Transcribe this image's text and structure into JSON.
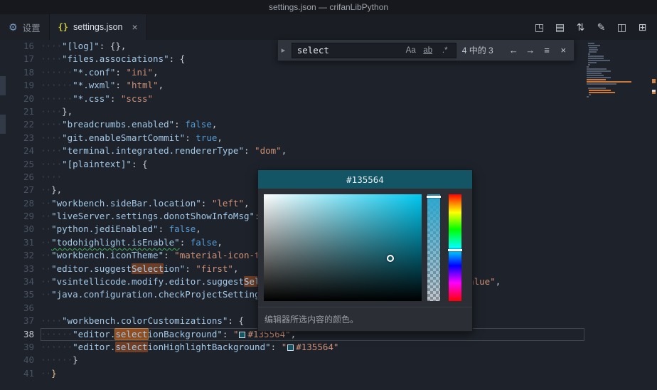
{
  "window": {
    "title": "settings.json — crifanLibPython"
  },
  "tab_bar": {
    "tabs": [
      {
        "label": "设置",
        "icon_name": "settings-gear-icon",
        "icon_glyph": "⚙",
        "icon_class": "ic-settings",
        "active": false
      },
      {
        "label": "settings.json",
        "icon_name": "json-braces-icon",
        "icon_glyph": "{}",
        "icon_class": "ic-json",
        "active": true,
        "close_glyph": "×"
      }
    ],
    "actions": [
      {
        "name": "open-changes-icon",
        "glyph": "◳"
      },
      {
        "name": "open-preview-icon",
        "glyph": "▤"
      },
      {
        "name": "synchronize-icon",
        "glyph": "⇅"
      },
      {
        "name": "edit-settings-icon",
        "glyph": "✎"
      },
      {
        "name": "split-editor-icon",
        "glyph": "◫"
      },
      {
        "name": "editor-layout-icon",
        "glyph": "⊞"
      }
    ]
  },
  "find_widget": {
    "collapse_glyph": "▸",
    "query": "select",
    "match_case_label": "Aa",
    "whole_word_label": "ab",
    "regex_label": ".*",
    "matches_label": "4 中的 3",
    "prev_glyph": "←",
    "next_glyph": "→",
    "selection_glyph": "≡",
    "close_glyph": "×"
  },
  "color_picker": {
    "hex": "#135564",
    "caption": "编辑器所选内容的颜色。"
  },
  "editor": {
    "lines": [
      {
        "num": 16,
        "tokens": [
          {
            "t": "ws",
            "n": 4
          },
          {
            "t": "key",
            "v": "\"[log]\""
          },
          {
            "t": "p",
            "v": ": "
          },
          {
            "t": "p",
            "v": "{},"
          }
        ]
      },
      {
        "num": 17,
        "tokens": [
          {
            "t": "ws",
            "n": 4
          },
          {
            "t": "key",
            "v": "\"files.associations\""
          },
          {
            "t": "p",
            "v": ": "
          },
          {
            "t": "p",
            "v": "{"
          }
        ]
      },
      {
        "num": 18,
        "tokens": [
          {
            "t": "ws",
            "n": 6
          },
          {
            "t": "key",
            "v": "\"*.conf\""
          },
          {
            "t": "p",
            "v": ": "
          },
          {
            "t": "str",
            "v": "\"ini\""
          },
          {
            "t": "p",
            "v": ","
          }
        ]
      },
      {
        "num": 19,
        "tokens": [
          {
            "t": "ws",
            "n": 6
          },
          {
            "t": "key",
            "v": "\"*.wxml\""
          },
          {
            "t": "p",
            "v": ": "
          },
          {
            "t": "str",
            "v": "\"html\""
          },
          {
            "t": "p",
            "v": ","
          }
        ]
      },
      {
        "num": 20,
        "tokens": [
          {
            "t": "ws",
            "n": 6
          },
          {
            "t": "key",
            "v": "\"*.css\""
          },
          {
            "t": "p",
            "v": ": "
          },
          {
            "t": "str",
            "v": "\"scss\""
          }
        ]
      },
      {
        "num": 21,
        "tokens": [
          {
            "t": "ws",
            "n": 4
          },
          {
            "t": "p",
            "v": "},"
          }
        ]
      },
      {
        "num": 22,
        "tokens": [
          {
            "t": "ws",
            "n": 4
          },
          {
            "t": "key",
            "v": "\"breadcrumbs.enabled\""
          },
          {
            "t": "p",
            "v": ": "
          },
          {
            "t": "bool",
            "v": "false"
          },
          {
            "t": "p",
            "v": ","
          }
        ]
      },
      {
        "num": 23,
        "tokens": [
          {
            "t": "ws",
            "n": 4
          },
          {
            "t": "key",
            "v": "\"git.enableSmartCommit\""
          },
          {
            "t": "p",
            "v": ": "
          },
          {
            "t": "bool",
            "v": "true"
          },
          {
            "t": "p",
            "v": ","
          }
        ]
      },
      {
        "num": 24,
        "tokens": [
          {
            "t": "ws",
            "n": 4
          },
          {
            "t": "key",
            "v": "\"terminal.integrated.rendererType\""
          },
          {
            "t": "p",
            "v": ": "
          },
          {
            "t": "str",
            "v": "\"dom\""
          },
          {
            "t": "p",
            "v": ","
          }
        ]
      },
      {
        "num": 25,
        "tokens": [
          {
            "t": "ws",
            "n": 4
          },
          {
            "t": "key",
            "v": "\"[plaintext]\""
          },
          {
            "t": "p",
            "v": ": "
          },
          {
            "t": "p",
            "v": "{"
          }
        ]
      },
      {
        "num": 26,
        "tokens": [
          {
            "t": "ws",
            "n": 4
          }
        ]
      },
      {
        "num": 27,
        "tokens": [
          {
            "t": "ws",
            "n": 2
          },
          {
            "t": "p",
            "v": "},"
          }
        ]
      },
      {
        "num": 28,
        "tokens": [
          {
            "t": "ws",
            "n": 2
          },
          {
            "t": "key",
            "v": "\"workbench.sideBar.location\""
          },
          {
            "t": "p",
            "v": ": "
          },
          {
            "t": "str",
            "v": "\"left\""
          },
          {
            "t": "p",
            "v": ","
          }
        ]
      },
      {
        "num": 29,
        "tokens": [
          {
            "t": "ws",
            "n": 2
          },
          {
            "t": "key",
            "v": "\"liveServer.settings.donotShowInfoMsg\""
          },
          {
            "t": "p",
            "v": ": "
          },
          {
            "t": "bool",
            "v": "true"
          },
          {
            "t": "p",
            "v": ","
          }
        ]
      },
      {
        "num": 30,
        "tokens": [
          {
            "t": "ws",
            "n": 2
          },
          {
            "t": "key",
            "v": "\"python.jediEnabled\""
          },
          {
            "t": "p",
            "v": ": "
          },
          {
            "t": "bool",
            "v": "false"
          },
          {
            "t": "p",
            "v": ","
          }
        ]
      },
      {
        "num": 31,
        "tokens": [
          {
            "t": "ws",
            "n": 2
          },
          {
            "t": "key",
            "v": "\"todohighlight.isEnable\"",
            "sq": 1
          },
          {
            "t": "p",
            "v": ": "
          },
          {
            "t": "bool",
            "v": "false"
          },
          {
            "t": "p",
            "v": ","
          }
        ]
      },
      {
        "num": 32,
        "tokens": [
          {
            "t": "ws",
            "n": 2
          },
          {
            "t": "key",
            "v": "\"workbench.iconTheme\""
          },
          {
            "t": "p",
            "v": ": "
          },
          {
            "t": "str",
            "v": "\"material-icon-theme\""
          },
          {
            "t": "p",
            "v": ","
          }
        ]
      },
      {
        "num": 33,
        "tokens": [
          {
            "t": "ws",
            "n": 2
          },
          {
            "t": "key",
            "v": "\"editor.suggest"
          },
          {
            "t": "key",
            "v": "Select",
            "hl": 1
          },
          {
            "t": "key",
            "v": "ion\""
          },
          {
            "t": "p",
            "v": ": "
          },
          {
            "t": "str",
            "v": "\"first\""
          },
          {
            "t": "p",
            "v": ","
          }
        ]
      },
      {
        "num": 34,
        "tokens": [
          {
            "t": "ws",
            "n": 2
          },
          {
            "t": "key",
            "v": "\"vsintellicode.modify.editor.suggest"
          },
          {
            "t": "key",
            "v": "Select",
            "hl": 1
          },
          {
            "t": "key",
            "v": "ion\""
          },
          {
            "t": "p",
            "v": ": "
          },
          {
            "t": "str",
            "v": "\"automaticallyOverrodeDefaultValue\""
          },
          {
            "t": "p",
            "v": ","
          }
        ]
      },
      {
        "num": 35,
        "tokens": [
          {
            "t": "ws",
            "n": 2
          },
          {
            "t": "key",
            "v": "\"java.configuration.checkProjectSettingsSchemas\""
          },
          {
            "t": "p",
            "v": ": "
          },
          {
            "t": "bool",
            "v": "true"
          },
          {
            "t": "p",
            "v": ","
          }
        ]
      },
      {
        "num": 36,
        "tokens": []
      },
      {
        "num": 37,
        "tokens": [
          {
            "t": "ws",
            "n": 4
          },
          {
            "t": "key",
            "v": "\"workbench.colorCustomizations\""
          },
          {
            "t": "p",
            "v": ": "
          },
          {
            "t": "p",
            "v": "{"
          }
        ]
      },
      {
        "num": 38,
        "current": true,
        "tokens": [
          {
            "t": "ws",
            "n": 6
          },
          {
            "t": "key",
            "v": "\"editor."
          },
          {
            "t": "key",
            "v": "select",
            "hl": 1,
            "cur": 1
          },
          {
            "t": "key",
            "v": "ionBackground\""
          },
          {
            "t": "p",
            "v": ": "
          },
          {
            "t": "str",
            "v": "\""
          },
          {
            "t": "swatch",
            "color": "#135564"
          },
          {
            "t": "str",
            "v": "#135564\""
          },
          {
            "t": "p",
            "v": ","
          }
        ]
      },
      {
        "num": 39,
        "tokens": [
          {
            "t": "ws",
            "n": 6
          },
          {
            "t": "key",
            "v": "\"editor."
          },
          {
            "t": "key",
            "v": "select",
            "hl": 1
          },
          {
            "t": "key",
            "v": "ionHighlightBackground\""
          },
          {
            "t": "p",
            "v": ": "
          },
          {
            "t": "str",
            "v": "\""
          },
          {
            "t": "swatch",
            "color": "#135564"
          },
          {
            "t": "str",
            "v": "#135564\""
          }
        ]
      },
      {
        "num": 40,
        "tokens": [
          {
            "t": "ws",
            "n": 6
          },
          {
            "t": "p",
            "v": "}"
          }
        ]
      },
      {
        "num": 41,
        "tokens": [
          {
            "t": "ws",
            "n": 2
          },
          {
            "t": "gold",
            "v": "}"
          }
        ]
      }
    ]
  }
}
